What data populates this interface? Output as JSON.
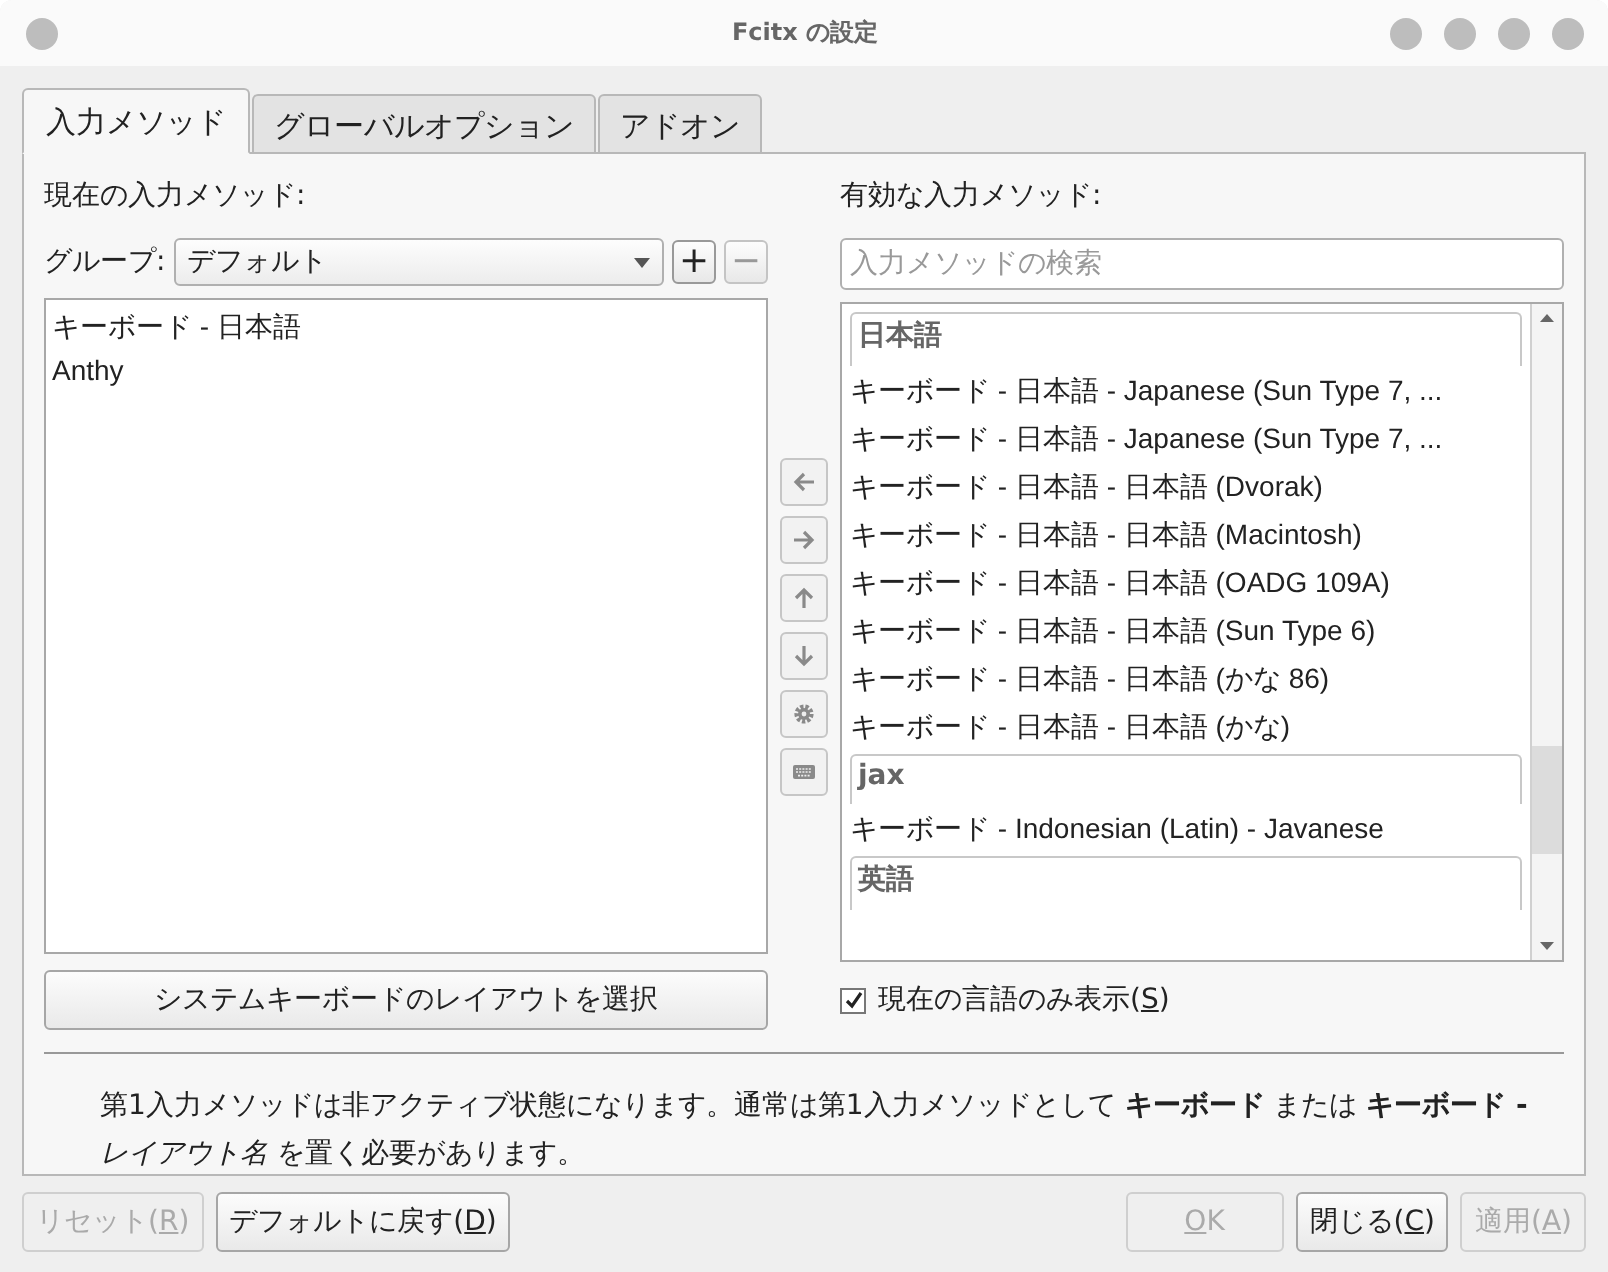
{
  "window": {
    "title": "Fcitx の設定"
  },
  "tabs": [
    {
      "label": "入力メソッド",
      "selected": true
    },
    {
      "label": "グローバルオプション",
      "selected": false
    },
    {
      "label": "アドオン",
      "selected": false
    }
  ],
  "current": {
    "heading": "現在の入力メソッド:",
    "group_label": "グループ:",
    "group_value": "デフォルト",
    "add_button": {
      "label": "+",
      "disabled": false
    },
    "remove_button": {
      "label": "−",
      "disabled": true
    },
    "items": [
      {
        "label": "キーボード - 日本語",
        "selected": false
      },
      {
        "label": "Anthy",
        "selected": false
      }
    ],
    "layout_button": "システムキーボードのレイアウトを選択"
  },
  "mid_buttons": [
    {
      "kind": "left",
      "disabled": true
    },
    {
      "kind": "right",
      "disabled": true
    },
    {
      "kind": "up",
      "disabled": true
    },
    {
      "kind": "down",
      "disabled": true
    },
    {
      "kind": "gear",
      "disabled": true
    },
    {
      "kind": "keyboard",
      "disabled": true
    }
  ],
  "available": {
    "heading": "有効な入力メソッド:",
    "search": {
      "placeholder": "入力メソッドの検索"
    },
    "groups": [
      {
        "name": "日本語",
        "items": [
          "キーボード - 日本語 - Japanese (Sun Type 7, ...",
          "キーボード - 日本語 - Japanese (Sun Type 7, ...",
          "キーボード - 日本語 - 日本語 (Dvorak)",
          "キーボード - 日本語 - 日本語 (Macintosh)",
          "キーボード - 日本語 - 日本語 (OADG 109A)",
          "キーボード - 日本語 - 日本語 (Sun Type 6)",
          "キーボード - 日本語 - 日本語 (かな 86)",
          "キーボード - 日本語 - 日本語 (かな)"
        ]
      },
      {
        "name": "jax",
        "items": [
          "キーボード - Indonesian (Latin) - Javanese"
        ]
      },
      {
        "name": "英語"
      }
    ],
    "only_current": {
      "pre": "現在の言語のみ表示(",
      "key": "S",
      "post": ")",
      "checked": true
    }
  },
  "message": "第1入力メソッドは非アクティブ状態になります。通常は第1入力メソッドとして **キーボード** または **キーボード -** *レイアウト名* を置く必要があります。",
  "buttons_left": [
    {
      "pre": "リセット(",
      "key": "R",
      "post": ")",
      "disabled": true
    },
    {
      "pre": "デフォルトに戻す(",
      "key": "D",
      "post": ")",
      "disabled": false
    }
  ],
  "buttons_right": [
    {
      "key": "O",
      "post": "K",
      "disabled": true
    },
    {
      "pre": "閉じる(",
      "key": "C",
      "post": ")",
      "disabled": false
    },
    {
      "pre": "適用(",
      "key": "A",
      "post": ")",
      "disabled": true
    }
  ]
}
